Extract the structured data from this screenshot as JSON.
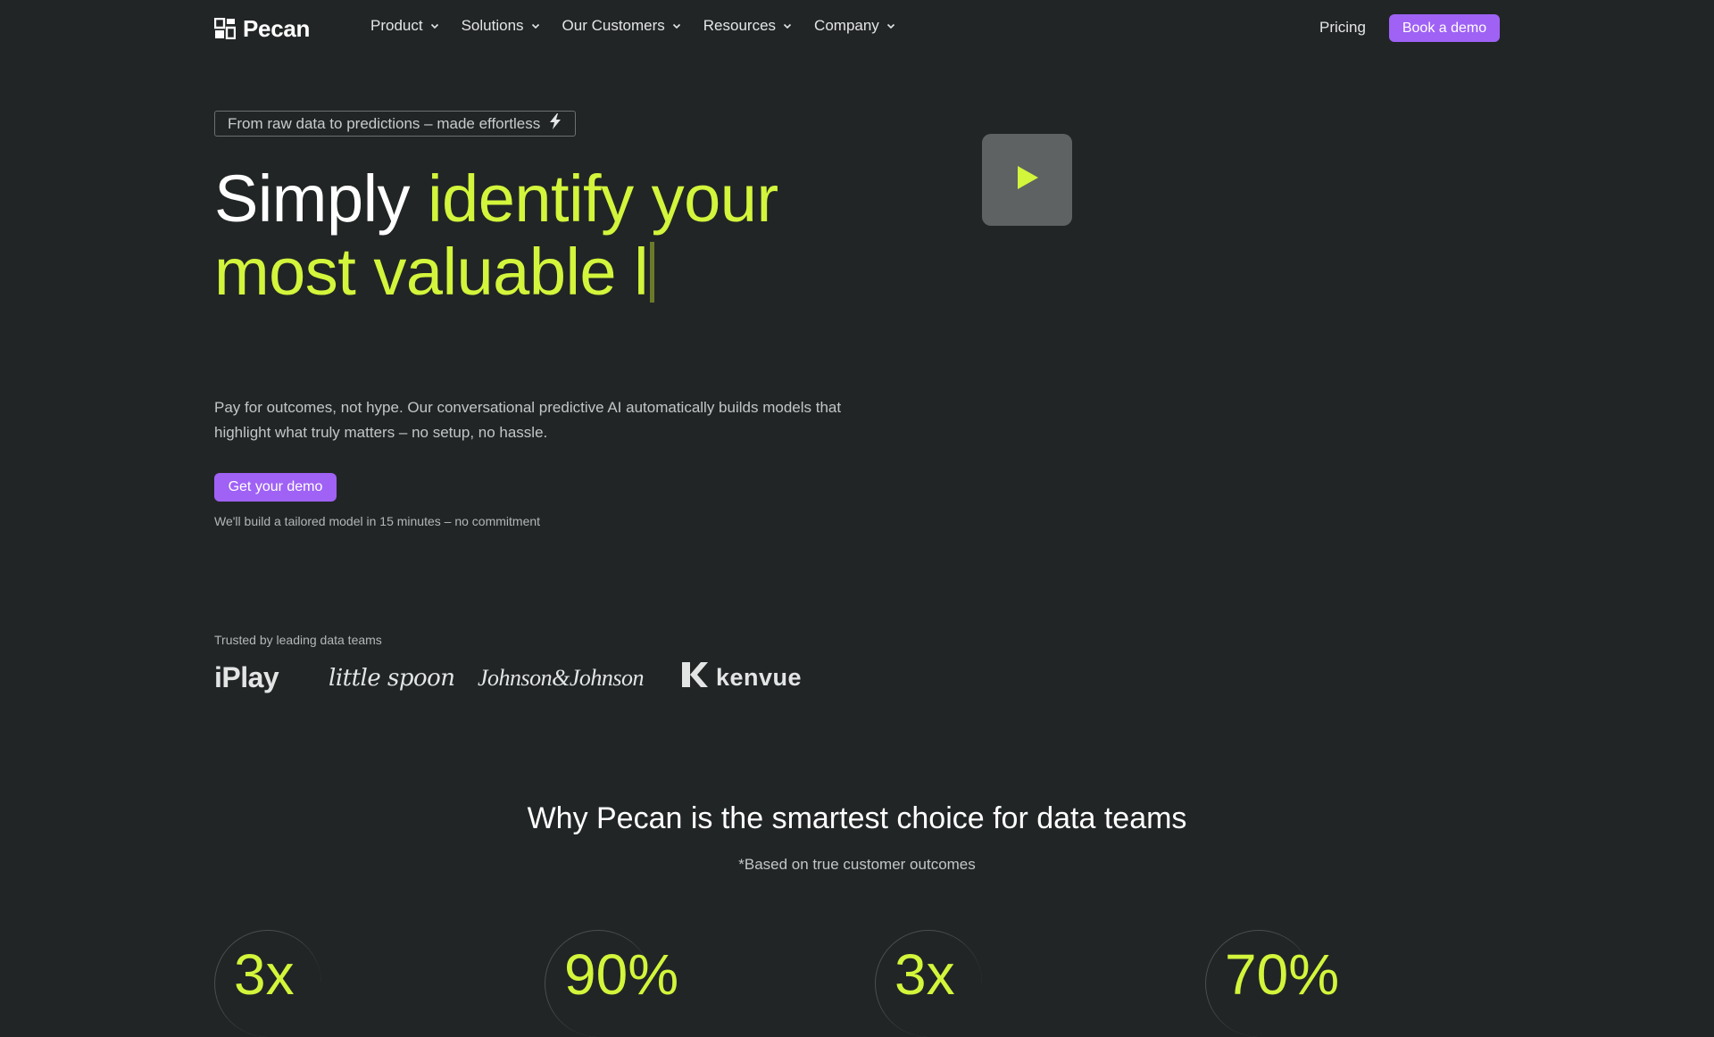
{
  "nav": {
    "logo_text": "Pecan",
    "items": [
      {
        "label": "Product"
      },
      {
        "label": "Solutions"
      },
      {
        "label": "Our Customers"
      },
      {
        "label": "Resources"
      },
      {
        "label": "Company"
      }
    ],
    "pricing_label": "Pricing",
    "demo_label": "Book a demo"
  },
  "hero": {
    "tagline": "From raw data to predictions – made effortless",
    "headline_white": "Simply ",
    "headline_lime": "identify your most valuable l",
    "description": "Pay for outcomes, not hype. Our conversational predictive AI automatically builds models that highlight what truly matters – no setup, no hassle.",
    "cta_label": "Get your demo",
    "cta_note": "We'll build a tailored model in 15 minutes – no commitment"
  },
  "trusted": {
    "label": "Trusted by leading data teams",
    "logos": [
      "iPlay",
      "little spoon",
      "Johnson&Johnson",
      "kenvue"
    ]
  },
  "why": {
    "title": "Why Pecan is the smartest choice for data teams",
    "subtitle": "*Based on true customer outcomes",
    "stats": [
      "3x",
      "90%",
      "3x",
      "70%"
    ]
  },
  "colors": {
    "background": "#222526",
    "accent_purple": "#9f62f5",
    "accent_lime": "#d3f53b"
  },
  "icons": [
    "pecan-logo-icon",
    "chevron-down-icon",
    "lightning-icon",
    "play-icon",
    "kenvue-k-icon"
  ]
}
